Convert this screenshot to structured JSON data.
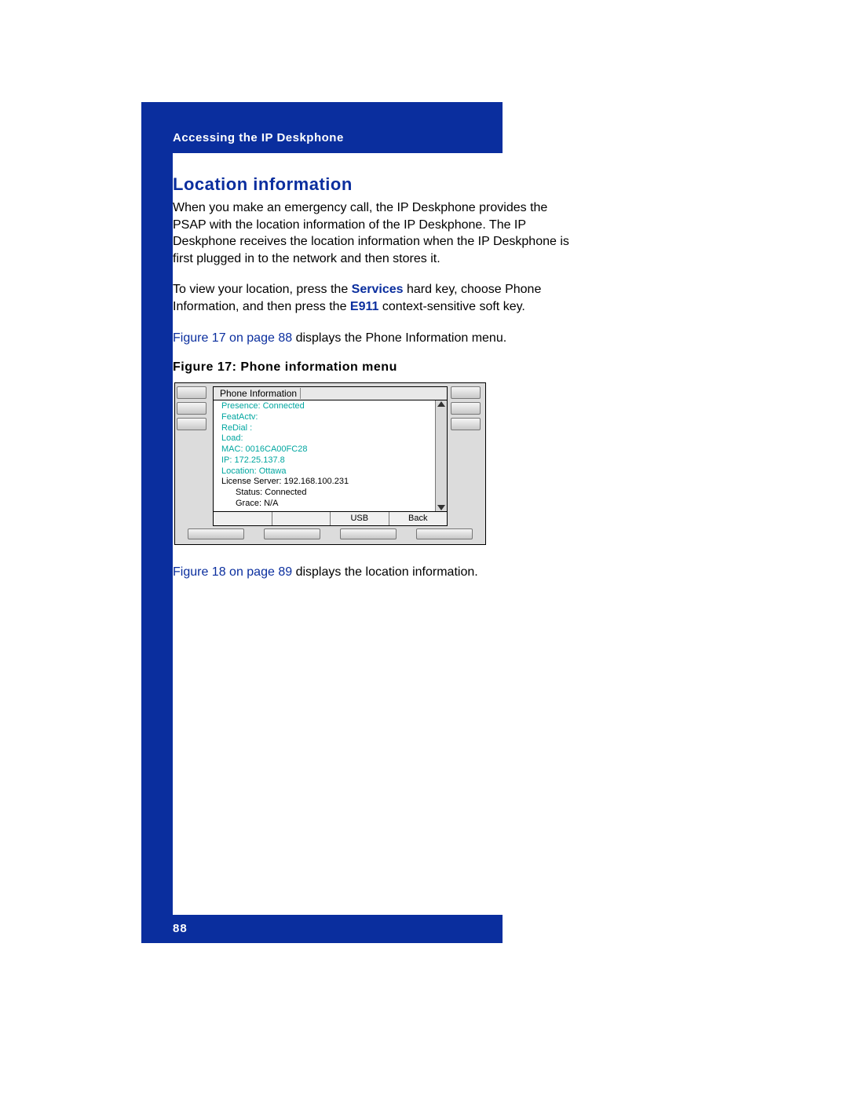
{
  "header": {
    "title": "Accessing the IP Deskphone"
  },
  "section": {
    "title": "Location information"
  },
  "paragraphs": {
    "p1": "When you make an emergency call, the IP Deskphone provides the PSAP with the location information of the IP Deskphone. The IP Deskphone receives the location information when the IP Deskphone is first plugged in to the network and then stores it.",
    "p2a": "To view your location, press the ",
    "p2_services": "Services",
    "p2b": " hard key, choose Phone Information, and then press the ",
    "p2_e911": "E911",
    "p2c": " context-sensitive soft key.",
    "p3_link": "Figure 17 on page 88",
    "p3_rest": " displays the Phone Information menu.",
    "p4_link": "Figure 18 on page 89",
    "p4_rest": " displays the location information."
  },
  "figure": {
    "caption": "Figure 17: Phone information menu",
    "lcd_title": "Phone Information",
    "lines": {
      "presence": "Presence:  Connected",
      "featactv": "FeatActv:",
      "redial": "ReDial  :",
      "load": "Load:",
      "mac": "MAC:  0016CA00FC28",
      "ip": "IP:  172.25.137.8",
      "location": "Location:  Ottawa",
      "license": "License Server: 192.168.100.231",
      "status": "Status: Connected",
      "grace": "Grace: N/A"
    },
    "softkeys": {
      "sk1": "",
      "sk2": "",
      "sk3": "USB",
      "sk4": "Back"
    }
  },
  "footer": {
    "page": "88"
  }
}
